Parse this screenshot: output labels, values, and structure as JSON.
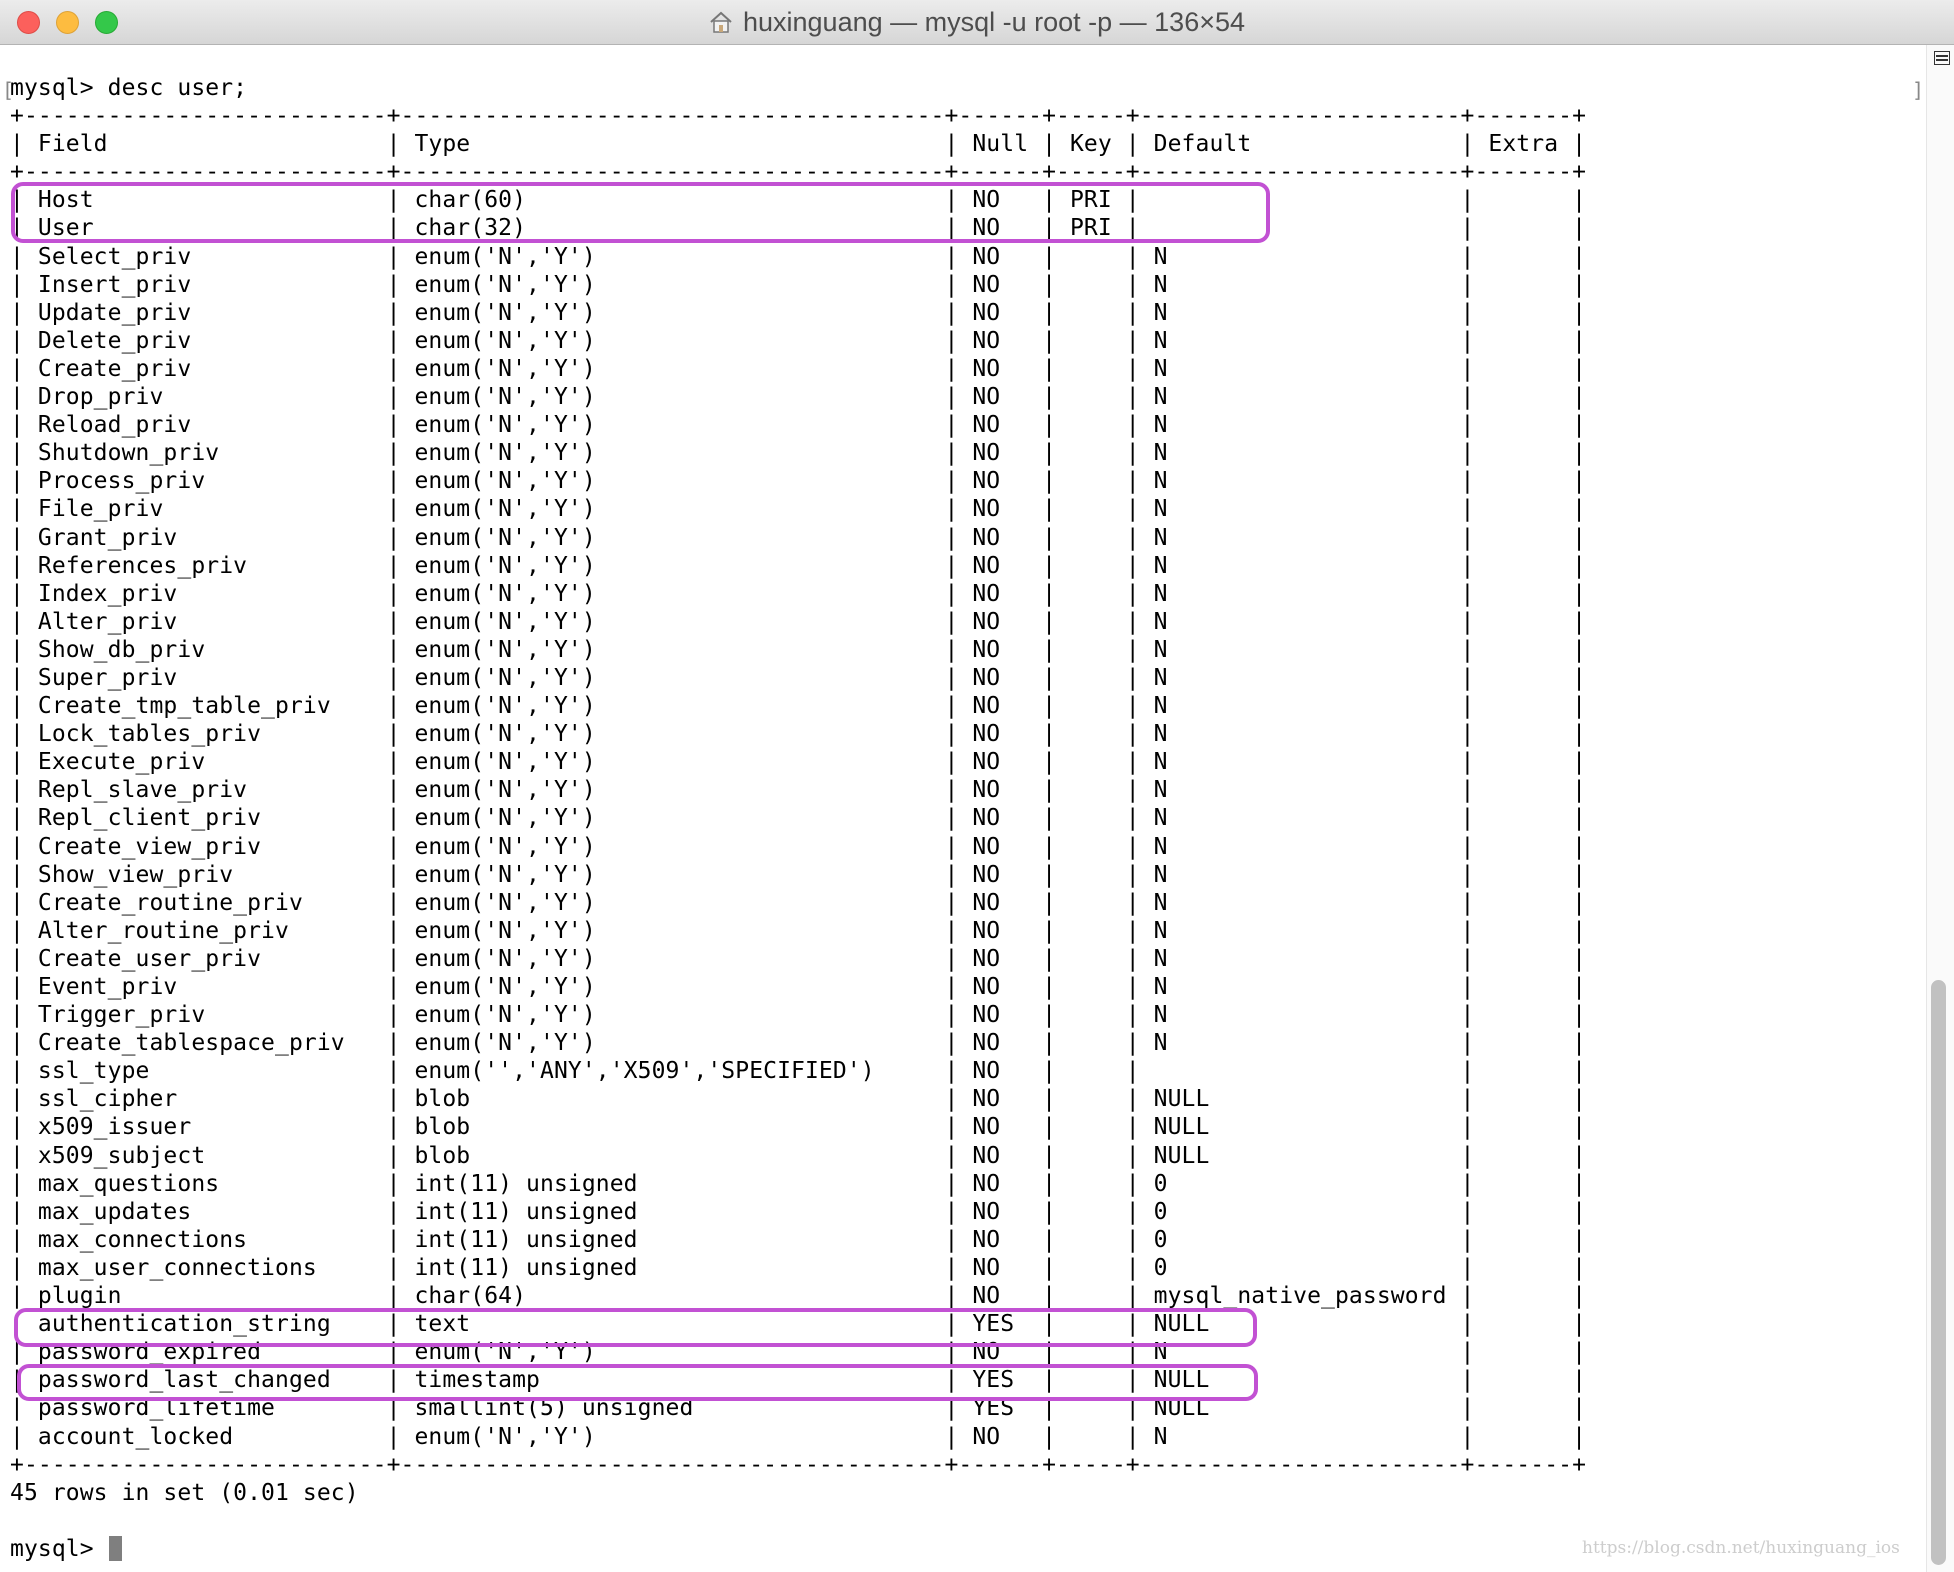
{
  "window": {
    "title": "huxinguang — mysql -u root -p — 136×54"
  },
  "terminal": {
    "lines": [
      "mysql> desc user;",
      "+--------------------------+---------------------------------------+------+-----+-----------------------+-------+",
      "| Field                    | Type                                  | Null | Key | Default               | Extra |",
      "+--------------------------+---------------------------------------+------+-----+-----------------------+-------+",
      "| Host                     | char(60)                              | NO   | PRI |                       |       |",
      "| User                     | char(32)                              | NO   | PRI |                       |       |",
      "| Select_priv              | enum('N','Y')                         | NO   |     | N                     |       |",
      "| Insert_priv              | enum('N','Y')                         | NO   |     | N                     |       |",
      "| Update_priv              | enum('N','Y')                         | NO   |     | N                     |       |",
      "| Delete_priv              | enum('N','Y')                         | NO   |     | N                     |       |",
      "| Create_priv              | enum('N','Y')                         | NO   |     | N                     |       |",
      "| Drop_priv                | enum('N','Y')                         | NO   |     | N                     |       |",
      "| Reload_priv              | enum('N','Y')                         | NO   |     | N                     |       |",
      "| Shutdown_priv            | enum('N','Y')                         | NO   |     | N                     |       |",
      "| Process_priv             | enum('N','Y')                         | NO   |     | N                     |       |",
      "| File_priv                | enum('N','Y')                         | NO   |     | N                     |       |",
      "| Grant_priv               | enum('N','Y')                         | NO   |     | N                     |       |",
      "| References_priv          | enum('N','Y')                         | NO   |     | N                     |       |",
      "| Index_priv               | enum('N','Y')                         | NO   |     | N                     |       |",
      "| Alter_priv               | enum('N','Y')                         | NO   |     | N                     |       |",
      "| Show_db_priv             | enum('N','Y')                         | NO   |     | N                     |       |",
      "| Super_priv               | enum('N','Y')                         | NO   |     | N                     |       |",
      "| Create_tmp_table_priv    | enum('N','Y')                         | NO   |     | N                     |       |",
      "| Lock_tables_priv         | enum('N','Y')                         | NO   |     | N                     |       |",
      "| Execute_priv             | enum('N','Y')                         | NO   |     | N                     |       |",
      "| Repl_slave_priv          | enum('N','Y')                         | NO   |     | N                     |       |",
      "| Repl_client_priv         | enum('N','Y')                         | NO   |     | N                     |       |",
      "| Create_view_priv         | enum('N','Y')                         | NO   |     | N                     |       |",
      "| Show_view_priv           | enum('N','Y')                         | NO   |     | N                     |       |",
      "| Create_routine_priv      | enum('N','Y')                         | NO   |     | N                     |       |",
      "| Alter_routine_priv       | enum('N','Y')                         | NO   |     | N                     |       |",
      "| Create_user_priv         | enum('N','Y')                         | NO   |     | N                     |       |",
      "| Event_priv               | enum('N','Y')                         | NO   |     | N                     |       |",
      "| Trigger_priv             | enum('N','Y')                         | NO   |     | N                     |       |",
      "| Create_tablespace_priv   | enum('N','Y')                         | NO   |     | N                     |       |",
      "| ssl_type                 | enum('','ANY','X509','SPECIFIED')     | NO   |     |                       |       |",
      "| ssl_cipher               | blob                                  | NO   |     | NULL                  |       |",
      "| x509_issuer              | blob                                  | NO   |     | NULL                  |       |",
      "| x509_subject             | blob                                  | NO   |     | NULL                  |       |",
      "| max_questions            | int(11) unsigned                      | NO   |     | 0                     |       |",
      "| max_updates              | int(11) unsigned                      | NO   |     | 0                     |       |",
      "| max_connections          | int(11) unsigned                      | NO   |     | 0                     |       |",
      "| max_user_connections     | int(11) unsigned                      | NO   |     | 0                     |       |",
      "| plugin                   | char(64)                              | NO   |     | mysql_native_password |       |",
      "| authentication_string    | text                                  | YES  |     | NULL                  |       |",
      "| password_expired         | enum('N','Y')                         | NO   |     | N                     |       |",
      "| password_last_changed    | timestamp                             | YES  |     | NULL                  |       |",
      "| password_lifetime        | smallint(5) unsigned                  | YES  |     | NULL                  |       |",
      "| account_locked           | enum('N','Y')                         | NO   |     | N                     |       |",
      "+--------------------------+---------------------------------------+------+-----+-----------------------+-------+",
      "45 rows in set (0.01 sec)",
      "",
      "mysql> "
    ]
  },
  "watermark": "https://blog.csdn.net/huxinguang_ios",
  "colors": {
    "highlight": "#c251d3",
    "terminal_background": "#ffffff",
    "terminal_text": "#000000"
  },
  "icons": {
    "title_icon": "home-icon",
    "scroll_indicator": "list-icon"
  }
}
